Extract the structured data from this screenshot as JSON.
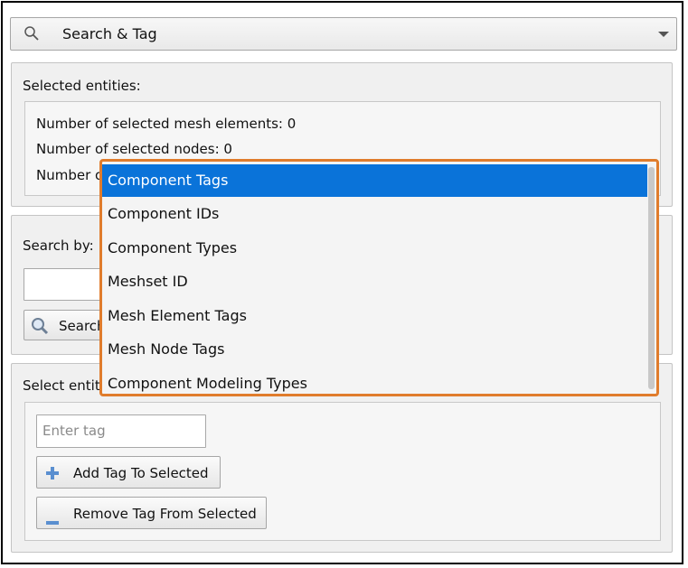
{
  "header": {
    "title": "Search & Tag",
    "search_icon": "search-icon",
    "dropdown_icon": "chevron-down-icon"
  },
  "selected": {
    "heading": "Selected entities:",
    "mesh_elements": "Number of selected mesh elements: 0",
    "nodes": "Number of selected nodes: 0",
    "third_line_partial": "Number o"
  },
  "search": {
    "label": "Search by:",
    "button_label": "Search",
    "button_icon": "magnifier-icon"
  },
  "select_tag": {
    "label_partial": "Select entit",
    "tag_placeholder": "Enter tag",
    "add_label": "Add Tag To Selected",
    "remove_label": "Remove Tag From Selected",
    "add_icon": "plus-icon",
    "remove_icon": "minus-icon"
  },
  "dropdown": {
    "options": [
      "Component Tags",
      "Component IDs",
      "Component Types",
      "Meshset ID",
      "Mesh Element Tags",
      "Mesh Node Tags",
      "Component Modeling Types"
    ],
    "selected_index": 0
  },
  "colors": {
    "highlight": "#0a73d9",
    "callout_border": "#e07c2c",
    "plus_icon": "#5a8fd0"
  }
}
